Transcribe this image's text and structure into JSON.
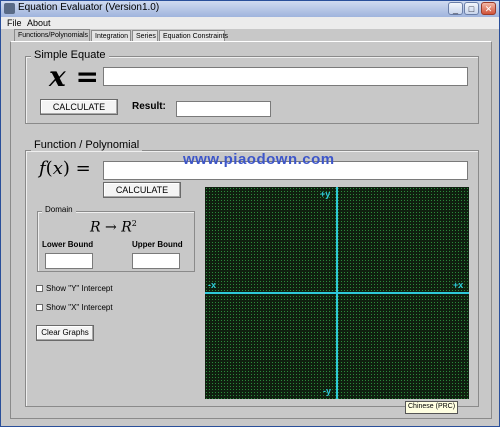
{
  "window": {
    "title": "Equation Evaluator (Version1.0)"
  },
  "menu": [
    "File",
    "About"
  ],
  "tabs": [
    "Functions/Polynomials",
    "Integration",
    "Series",
    "Equation Constraints"
  ],
  "simple": {
    "group_title": "Simple Equate",
    "x_symbol": "x =",
    "calculate": "CALCULATE",
    "result_label": "Result:",
    "equation_value": "",
    "result_value": ""
  },
  "function": {
    "group_title": "Function / Polynomial",
    "fx_symbol": "f(x) =",
    "calculate": "CALCULATE",
    "function_value": "",
    "domain": {
      "title": "Domain",
      "mapping": "R → R²",
      "lower_label": "Lower Bound",
      "upper_label": "Upper Bound",
      "lower_value": "",
      "upper_value": ""
    },
    "show_y_label": "Show \"Y\" Intercept",
    "show_x_label": "Show \"X\" Intercept",
    "show_y_checked": false,
    "show_x_checked": false,
    "clear_graphs": "Clear Graphs"
  },
  "graph": {
    "plus_y": "+y",
    "minus_y": "-y",
    "plus_x": "+x",
    "minus_x": "-x"
  },
  "watermark": "www.piaodown.com",
  "tooltip": "Chinese (PRC)",
  "colors": {
    "plot_bg": "#0f1f0f",
    "grid_dots": "#2a8a3a",
    "axes": "#2ec9d9",
    "watermark": "#3d56c9"
  }
}
